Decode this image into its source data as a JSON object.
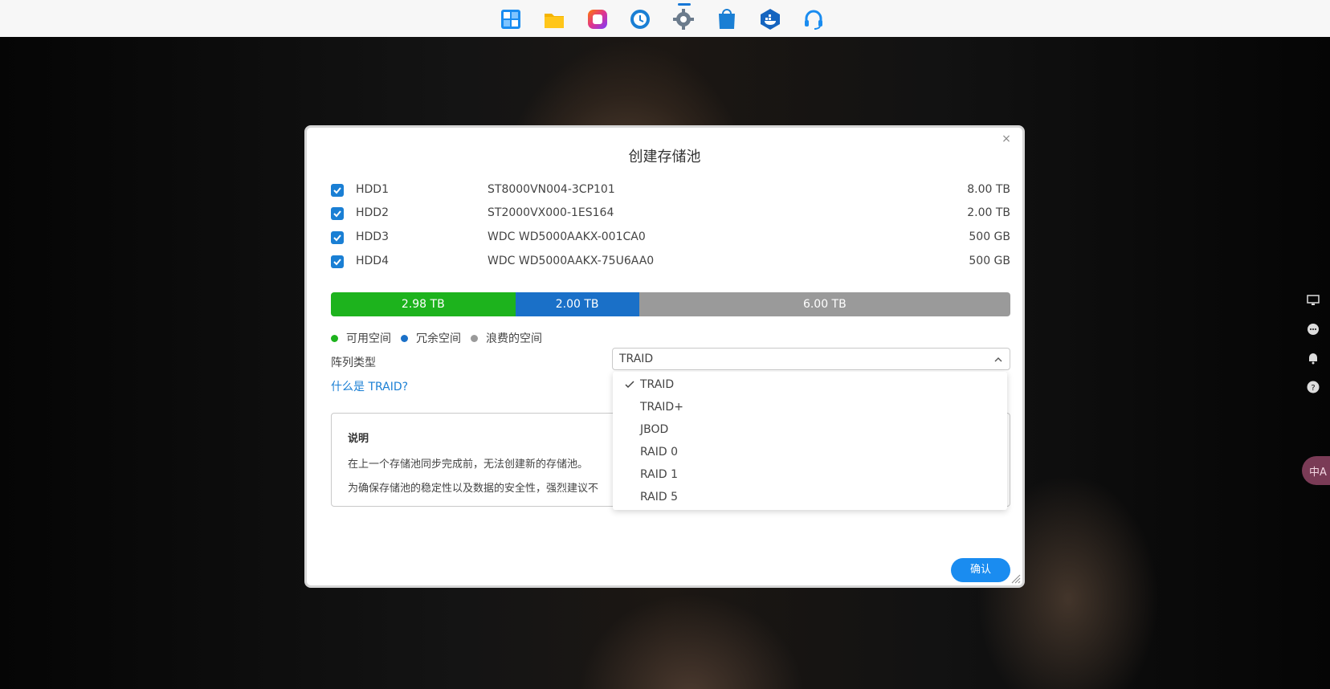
{
  "taskbar": {
    "apps": [
      {
        "name": "control-panel-app",
        "color": "#1a8cf0"
      },
      {
        "name": "file-manager-app",
        "color": "#f5b400"
      },
      {
        "name": "photos-app",
        "color": "#e0338f"
      },
      {
        "name": "backup-app",
        "color": "#1a7fd4"
      },
      {
        "name": "settings-app",
        "color": "#6b7b8c"
      },
      {
        "name": "app-store-app",
        "color": "#1a7fd4"
      },
      {
        "name": "docker-app",
        "color": "#1565c0"
      },
      {
        "name": "support-app",
        "color": "#1a8cf0"
      }
    ]
  },
  "side_tools": [
    "monitor-icon",
    "chat-icon",
    "bell-icon",
    "help-icon"
  ],
  "translate_button": "中A",
  "dialog": {
    "title": "创建存储池",
    "close_label": "×",
    "disks": [
      {
        "name": "HDD1",
        "model": "ST8000VN004-3CP101",
        "size": "8.00 TB",
        "checked": true
      },
      {
        "name": "HDD2",
        "model": "ST2000VX000-1ES164",
        "size": "2.00 TB",
        "checked": true
      },
      {
        "name": "HDD3",
        "model": "WDC WD5000AAKX-001CA0",
        "size": "500 GB",
        "checked": true
      },
      {
        "name": "HDD4",
        "model": "WDC WD5000AAKX-75U6AA0",
        "size": "500 GB",
        "checked": true
      }
    ],
    "capacity": {
      "segments": [
        {
          "label": "2.98 TB",
          "value_tb": 2.98,
          "color": "#1db31d"
        },
        {
          "label": "2.00 TB",
          "value_tb": 2.0,
          "color": "#1a70c8"
        },
        {
          "label": "6.00 TB",
          "value_tb": 6.0,
          "color": "#9a9a9a"
        }
      ]
    },
    "legend": [
      {
        "label": "可用空间",
        "color": "#1db31d"
      },
      {
        "label": "冗余空间",
        "color": "#1a70c8"
      },
      {
        "label": "浪费的空间",
        "color": "#9a9a9a"
      }
    ],
    "array_type_label": "阵列类型",
    "array_type_value": "TRAID",
    "what_is_traid": "什么是 TRAID?",
    "info": {
      "title": "说明",
      "lines": [
        "在上一个存储池同步完成前，无法创建新的存储池。",
        "为确保存储池的稳定性以及数据的安全性，强烈建议不"
      ]
    },
    "dropdown_options": [
      {
        "label": "TRAID",
        "selected": true
      },
      {
        "label": "TRAID+",
        "selected": false
      },
      {
        "label": "JBOD",
        "selected": false
      },
      {
        "label": "RAID 0",
        "selected": false
      },
      {
        "label": "RAID 1",
        "selected": false
      },
      {
        "label": "RAID 5",
        "selected": false
      }
    ],
    "confirm_label": "确认"
  }
}
